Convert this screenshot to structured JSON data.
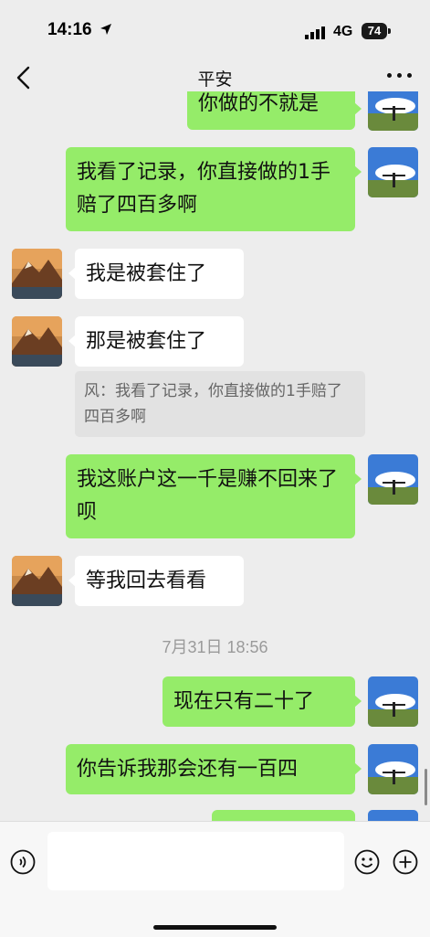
{
  "status_bar": {
    "time": "14:16",
    "network": "4G",
    "battery": "74"
  },
  "header": {
    "title": "平安"
  },
  "messages": [
    {
      "text": "你做的不就是"
    },
    {
      "text": "我看了记录，你直接做的1手赔了四百多啊"
    },
    {
      "text": "我是被套住了"
    },
    {
      "text": "那是被套住了"
    },
    {
      "quote": "风：我看了记录，你直接做的1手赔了四百多啊"
    },
    {
      "text": "我这账户这一千是赚不回来了呗"
    },
    {
      "text": "等我回去看看"
    },
    {
      "timestamp": "7月31日 18:56"
    },
    {
      "text": "现在只有二十了"
    },
    {
      "text": "你告诉我那会还有一百四"
    }
  ],
  "input": {
    "value": ""
  },
  "icons": {
    "back": "chevron-left-icon",
    "more": "more-icon",
    "voice": "voice-icon",
    "emoji": "emoji-icon",
    "plus": "plus-icon",
    "location": "location-arrow-icon",
    "signal": "signal-icon",
    "battery": "battery-icon"
  },
  "colors": {
    "outgoing_bubble": "#95ec69",
    "incoming_bubble": "#ffffff",
    "background": "#ededed"
  }
}
